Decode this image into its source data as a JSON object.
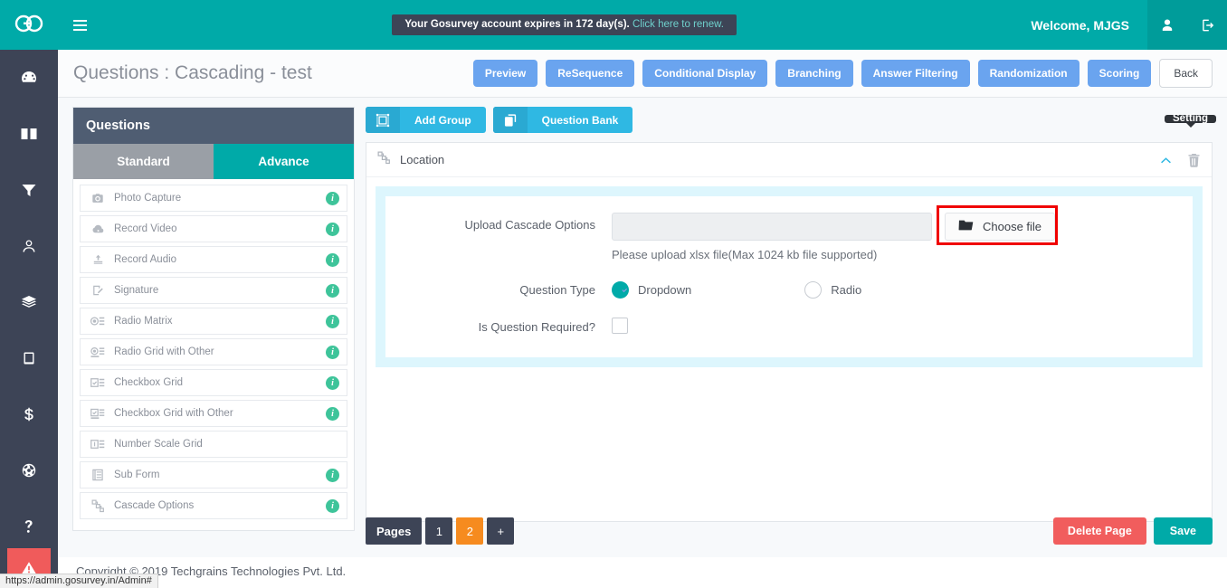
{
  "topbar": {
    "logo": "go-logo",
    "menu_icon": "hamburger-icon",
    "expiry_text": "Your Gosurvey account expires in 172 day(s).",
    "expiry_link": "Click here to renew.",
    "welcome": "Welcome, MJGS",
    "user_icon": "user-icon",
    "logout_icon": "logout-icon"
  },
  "rail": {
    "items": [
      {
        "icon": "dashboard-gauge-icon"
      },
      {
        "icon": "book-icon"
      },
      {
        "icon": "filter-icon"
      },
      {
        "icon": "user-icon"
      },
      {
        "icon": "layers-icon"
      },
      {
        "icon": "tablet-icon"
      },
      {
        "icon": "dollar-icon"
      },
      {
        "icon": "globe-icon"
      },
      {
        "icon": "question-mark-icon"
      }
    ],
    "alert_icon": "warning-triangle-icon"
  },
  "header": {
    "title": "Questions : Cascading - test",
    "buttons": [
      {
        "label": "Preview",
        "style": "blue"
      },
      {
        "label": "ReSequence",
        "style": "blue"
      },
      {
        "label": "Conditional Display",
        "style": "blue"
      },
      {
        "label": "Branching",
        "style": "blue"
      },
      {
        "label": "Answer Filtering",
        "style": "blue"
      },
      {
        "label": "Randomization",
        "style": "blue"
      },
      {
        "label": "Scoring",
        "style": "blue"
      }
    ],
    "back_label": "Back"
  },
  "questions_panel": {
    "title": "Questions",
    "tabs": [
      {
        "label": "Standard",
        "active": false
      },
      {
        "label": "Advance",
        "active": true
      }
    ],
    "items": [
      {
        "label": "Photo Capture",
        "icon": "camera-icon",
        "info": true
      },
      {
        "label": "Record Video",
        "icon": "video-cloud-icon",
        "info": true
      },
      {
        "label": "Record Audio",
        "icon": "microphone-upload-icon",
        "info": true
      },
      {
        "label": "Signature",
        "icon": "signature-icon",
        "info": true
      },
      {
        "label": "Radio Matrix",
        "icon": "radio-matrix-icon",
        "info": true
      },
      {
        "label": "Radio Grid with Other",
        "icon": "radio-grid-other-icon",
        "info": true
      },
      {
        "label": "Checkbox Grid",
        "icon": "checkbox-grid-icon",
        "info": true
      },
      {
        "label": "Checkbox Grid with Other",
        "icon": "checkbox-grid-other-icon",
        "info": true
      },
      {
        "label": "Number Scale Grid",
        "icon": "number-scale-grid-icon",
        "info": false
      },
      {
        "label": "Sub Form",
        "icon": "sub-form-icon",
        "info": true
      },
      {
        "label": "Cascade Options",
        "icon": "cascade-options-icon",
        "info": true
      }
    ],
    "info_glyph": "i"
  },
  "work": {
    "toolbar": [
      {
        "label": "Add Group",
        "icon": "add-group-icon"
      },
      {
        "label": "Question Bank",
        "icon": "question-bank-icon"
      }
    ],
    "card": {
      "icon": "cascade-options-icon",
      "title": "Location",
      "tooltip": "Setting",
      "collapse_icon": "chevron-up-icon",
      "delete_icon": "trash-icon"
    },
    "form": {
      "upload_label": "Upload Cascade Options",
      "upload_value": "",
      "choose_file_label": "Choose file",
      "choose_file_icon": "folder-icon",
      "hint": "Please upload xlsx file(Max 1024 kb file supported)",
      "question_type_label": "Question Type",
      "options": [
        {
          "label": "Dropdown",
          "selected": true
        },
        {
          "label": "Radio",
          "selected": false
        }
      ],
      "required_label": "Is Question Required?",
      "required_checked": false
    }
  },
  "footer": {
    "pages_label": "Pages",
    "pages": [
      {
        "label": "1",
        "active": false
      },
      {
        "label": "2",
        "active": true
      }
    ],
    "add_page_label": "+",
    "delete_page_label": "Delete Page",
    "save_label": "Save"
  },
  "copyright": "Copyright © 2019 Techgrains Technologies Pvt. Ltd.",
  "statusbar": "https://admin.gosurvey.in/Admin#",
  "colors": {
    "teal": "#00aaa8",
    "dark_slate": "#3d4456",
    "blue_button": "#6aa4ef",
    "light_blue": "#2fb8e3",
    "orange": "#f68b1f",
    "red": "#f15d5d",
    "highlight_red": "#f00000",
    "cyan_panel": "#ddf6fd",
    "green_info": "#3ec49a"
  }
}
